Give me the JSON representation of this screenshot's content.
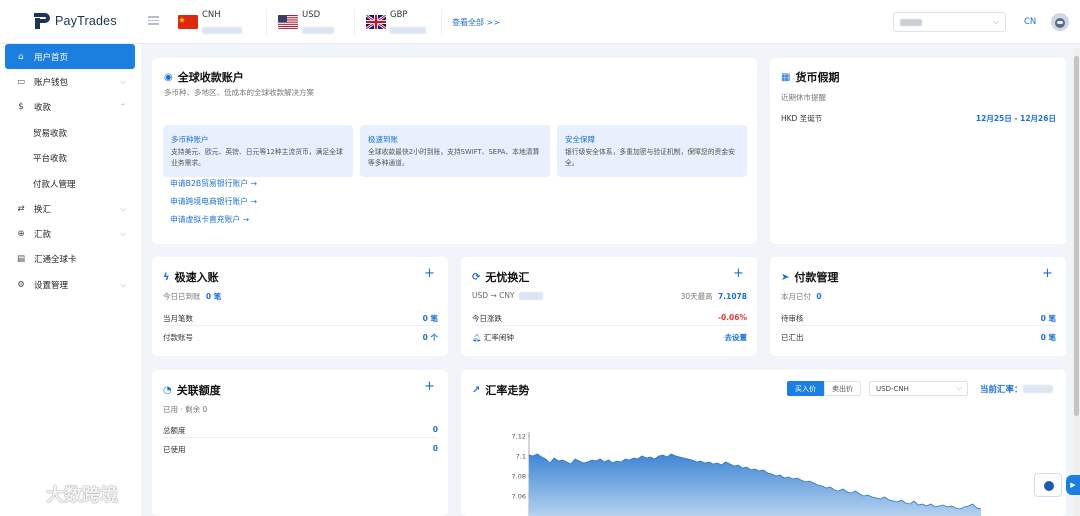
{
  "brand": {
    "name": "PayTrades"
  },
  "topbar": {
    "currencies": [
      {
        "code": "CNH",
        "flag": "cn-flag"
      },
      {
        "code": "USD",
        "flag": "us-flag"
      },
      {
        "code": "GBP",
        "flag": "gb-flag"
      }
    ],
    "view_all": "查看全部 >>",
    "language": "CN"
  },
  "sidebar": {
    "items": [
      {
        "label": "用户首页",
        "icon": "home-icon"
      },
      {
        "label": "账户钱包",
        "icon": "wallet-icon"
      },
      {
        "label": "收款",
        "icon": "dollar-icon"
      },
      {
        "label": "贸易收款"
      },
      {
        "label": "平台收款"
      },
      {
        "label": "付款人管理"
      },
      {
        "label": "换汇",
        "icon": "exchange-icon"
      },
      {
        "label": "汇款",
        "icon": "remit-icon"
      },
      {
        "label": "汇通全球卡",
        "icon": "card-icon"
      },
      {
        "label": "设置管理",
        "icon": "gear-icon"
      }
    ]
  },
  "global_account": {
    "title": "全球收款账户",
    "subtitle": "多币种、多地区、低成本的全球收款解决方案",
    "features": [
      {
        "title": "多币种账户",
        "desc": "支持美元、欧元、英镑、日元等12种主流货币，满足全球业务需求。"
      },
      {
        "title": "极速到账",
        "desc": "全球收款最快2小时到账，支持SWIFT、SEPA、本地清算等多种通道。"
      },
      {
        "title": "安全保障",
        "desc": "银行级安全体系，多重加密与验证机制，保障您的资金安全。"
      }
    ],
    "links": [
      "申请B2B贸易银行账户 →",
      "申请跨境电商银行账户 →",
      "申请虚拟卡直充账户 →"
    ]
  },
  "holiday": {
    "title": "货币假期",
    "subtitle": "近期休市提醒",
    "rows": [
      {
        "name": "HKD 圣诞节",
        "dates": "12月25日 - 12月26日"
      }
    ]
  },
  "fast_credit": {
    "title": "极速入账",
    "today_label": "今日已到账",
    "today_value": "0 笔",
    "rows": [
      {
        "label": "当月笔数",
        "value": "0 笔"
      },
      {
        "label": "付款账号",
        "value": "0 个"
      }
    ]
  },
  "fx": {
    "title": "无忧换汇",
    "pair": "USD → CNY",
    "high_label": "30天最高",
    "high_value": "7.1078",
    "rows": [
      {
        "label": "今日涨跌",
        "value": "-0.06%"
      },
      {
        "label": "汇率闹钟",
        "value": "去设置"
      }
    ]
  },
  "payment_mgmt": {
    "title": "付款管理",
    "month_label": "本月已付",
    "month_value": "0",
    "rows": [
      {
        "label": "待审核",
        "value": "0 笔"
      },
      {
        "label": "已汇出",
        "value": "0 笔"
      }
    ]
  },
  "quota": {
    "title": "关联额度",
    "subtitle": "已用 · 剩余 0",
    "rows": [
      {
        "label": "总额度",
        "value": "0"
      },
      {
        "label": "已使用",
        "value": "0"
      }
    ]
  },
  "trend": {
    "title": "汇率走势",
    "buy_label": "买入价",
    "sell_label": "卖出价",
    "pair_select": "USD-CNH",
    "current_label": "当前汇率："
  },
  "watermark": "大数跨境",
  "colors": {
    "accent": "#1b7fe0",
    "negative": "#e23b3b"
  },
  "chart_data": {
    "type": "area",
    "title": "",
    "xlabel": "",
    "ylabel": "",
    "yticks": [
      7.12,
      7.1,
      7.08,
      7.06
    ],
    "ylim": [
      7.046,
      7.12
    ],
    "series": [
      {
        "values": [
          7.101,
          7.1,
          7.102,
          7.099,
          7.097,
          7.093,
          7.098,
          7.095,
          7.096,
          7.094,
          7.092,
          7.097,
          7.095,
          7.093,
          7.094,
          7.096,
          7.095,
          7.097,
          7.094,
          7.096,
          7.093,
          7.095,
          7.094,
          7.097,
          7.096,
          7.098,
          7.097,
          7.1,
          7.098,
          7.099,
          7.097,
          7.1,
          7.101,
          7.099,
          7.102,
          7.1,
          7.099,
          7.098,
          7.097,
          7.096,
          7.094,
          7.095,
          7.093,
          7.094,
          7.092,
          7.093,
          7.091,
          7.094,
          7.092,
          7.09,
          7.091,
          7.088,
          7.089,
          7.086,
          7.087,
          7.085,
          7.086,
          7.083,
          7.082,
          7.08,
          7.081,
          7.078,
          7.079,
          7.077,
          7.078,
          7.076,
          7.074,
          7.075,
          7.073,
          7.071,
          7.07,
          7.068,
          7.069,
          7.066,
          7.065,
          7.067,
          7.064,
          7.063,
          7.065,
          7.062,
          7.06,
          7.061,
          7.059,
          7.058,
          7.057,
          7.059,
          7.056,
          7.055,
          7.054,
          7.056,
          7.053,
          7.052,
          7.055,
          7.051,
          7.052,
          7.05,
          7.052,
          7.049,
          7.05,
          7.051,
          7.049,
          7.05,
          7.048,
          7.047,
          7.049,
          7.05,
          7.052,
          7.048,
          7.047
        ]
      }
    ]
  }
}
